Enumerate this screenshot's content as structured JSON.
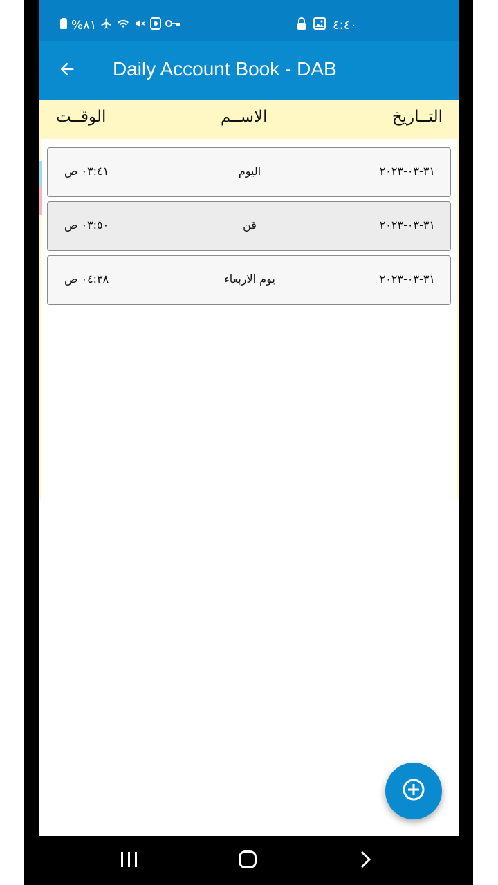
{
  "status_bar": {
    "battery_text": "%٨١",
    "clock": "٤:٤٠",
    "left_icons": [
      "battery-icon",
      "airplane-icon",
      "wifi-icon",
      "mute-icon",
      "recycle-icon",
      "key-icon"
    ],
    "right_icons": [
      "lock-icon",
      "gallery-icon"
    ]
  },
  "app_bar": {
    "title": "Daily Account Book - DAB",
    "back_icon": "arrow-left-icon"
  },
  "columns": {
    "date": "التــاريخ",
    "name": "الاســم",
    "time": "الوقــت"
  },
  "rows": [
    {
      "date": "٣١-٠٣-٢٠٢٣",
      "name": "اليوم",
      "time": "٠٣:٤١ ص"
    },
    {
      "date": "٣١-٠٣-٢٠٢٣",
      "name": "قن",
      "time": "٠٣:٥٠ ص"
    },
    {
      "date": "٣١-٠٣-٢٠٢٣",
      "name": "يوم الاربعاء",
      "time": "٠٤:٣٨ ص"
    }
  ],
  "fab": {
    "icon": "plus-circle-icon"
  },
  "nav_bar": {
    "icons": [
      "recents-icon",
      "home-icon",
      "back-chevron-icon"
    ]
  },
  "colors": {
    "status_bar": "#0880c6",
    "app_bar": "#0a8bd0",
    "header_bg": "#fff8c4",
    "row_bg": "#f7f7f7",
    "row_alt_bg": "#ececec"
  }
}
